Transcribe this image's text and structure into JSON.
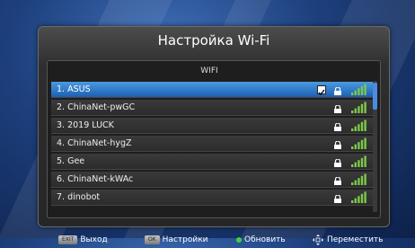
{
  "dialog": {
    "title": "Настройка Wi-Fi"
  },
  "list": {
    "header": "WIFI",
    "items": [
      {
        "label": "1.  ASUS",
        "selected": true,
        "checked": true,
        "locked": true,
        "signal": 4
      },
      {
        "label": "2.  ChinaNet-pwGC",
        "selected": false,
        "checked": false,
        "locked": true,
        "signal": 4
      },
      {
        "label": "3.  2019 LUCK",
        "selected": false,
        "checked": false,
        "locked": true,
        "signal": 4
      },
      {
        "label": "4.  ChinaNet-hygZ",
        "selected": false,
        "checked": false,
        "locked": true,
        "signal": 4
      },
      {
        "label": "5.  Gee",
        "selected": false,
        "checked": false,
        "locked": true,
        "signal": 4
      },
      {
        "label": "6.  ChinaNet-kWAc",
        "selected": false,
        "checked": false,
        "locked": true,
        "signal": 4
      },
      {
        "label": "7.  dinobot",
        "selected": false,
        "checked": false,
        "locked": true,
        "signal": 4
      }
    ]
  },
  "footer": {
    "exit_key": "EXIT",
    "exit_label": "Выход",
    "ok_key": "OK",
    "settings_label": "Настройки",
    "refresh_label": "Обновить",
    "move_label": "Переместить"
  },
  "colors": {
    "selected": "#2a75cc",
    "signal": "#7cc84a",
    "refresh_dot": "#3fd43f"
  }
}
